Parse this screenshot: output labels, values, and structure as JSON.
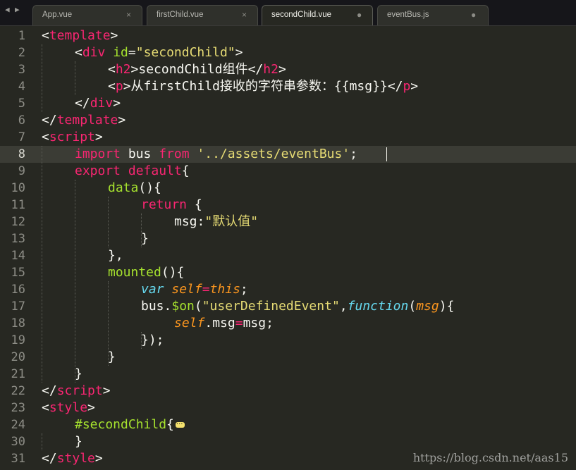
{
  "tabs": [
    {
      "label": "App.vue",
      "control": "×"
    },
    {
      "label": "firstChild.vue",
      "control": "×"
    },
    {
      "label": "secondChild.vue",
      "control": "●"
    },
    {
      "label": "eventBus.js",
      "control": "●"
    }
  ],
  "nav": {
    "back": "◀",
    "forward": "▶"
  },
  "line_numbers": [
    "1",
    "2",
    "3",
    "4",
    "5",
    "6",
    "7",
    "8",
    "9",
    "10",
    "11",
    "12",
    "13",
    "14",
    "15",
    "16",
    "17",
    "18",
    "19",
    "20",
    "21",
    "22",
    "23",
    "24",
    "30",
    "31"
  ],
  "code": {
    "l1": {
      "open": "<",
      "tag": "template",
      "close": ">"
    },
    "l2": {
      "open": "<",
      "tag": "div",
      "attr": "id",
      "eq": "=",
      "val": "\"secondChild\"",
      "close": ">"
    },
    "l3": {
      "open": "<",
      "tag": "h2",
      "close": ">",
      "text": "secondChild组件",
      "endopen": "</",
      "endtag": "h2",
      "endclose": ">"
    },
    "l4": {
      "open": "<",
      "tag": "p",
      "close": ">",
      "text": "从firstChild接收的字符串参数：{{msg}}",
      "endopen": "</",
      "endtag": "p",
      "endclose": ">"
    },
    "l5": {
      "open": "</",
      "tag": "div",
      "close": ">"
    },
    "l6": {
      "open": "</",
      "tag": "template",
      "close": ">"
    },
    "l7": {
      "open": "<",
      "tag": "script",
      "close": ">"
    },
    "l8": {
      "kw1": "import",
      "name": " bus ",
      "kw2": "from",
      "sp": " ",
      "str": "'../assets/eventBus'",
      "semi": ";"
    },
    "l9": {
      "kw1": "export",
      "sp": " ",
      "kw2": "default",
      "brace": "{"
    },
    "l10": {
      "fn": "data",
      "rest": "(){"
    },
    "l11": {
      "kw": "return",
      "rest": " {"
    },
    "l12": {
      "key": "msg:",
      "str": "\"默认值\""
    },
    "l13": {
      "text": "}"
    },
    "l14": {
      "text": "},"
    },
    "l15": {
      "fn": "mounted",
      "rest": "(){"
    },
    "l16": {
      "var": "var",
      "sp": " ",
      "self": "self",
      "eq": "=",
      "this": "this",
      "semi": ";"
    },
    "l17": {
      "obj": "bus.",
      "fn": "$on",
      "p1": "(",
      "str": "\"userDefinedEvent\"",
      "comma": ",",
      "func": "function",
      "p2": "(",
      "param": "msg",
      "p3": "){"
    },
    "l18": {
      "self": "self",
      "mid": ".msg",
      "eq": "=",
      "rest": "msg;"
    },
    "l19": {
      "text": "});"
    },
    "l20": {
      "text": "}"
    },
    "l21": {
      "text": "}"
    },
    "l22": {
      "open": "</",
      "tag": "script",
      "close": ">"
    },
    "l23": {
      "open": "<",
      "tag": "style",
      "close": ">"
    },
    "l24": {
      "sel": "#secondChild",
      "brace": "{"
    },
    "l30": {
      "text": "}"
    },
    "l31": {
      "open": "</",
      "tag": "style",
      "close": ">"
    }
  },
  "watermark": "https://blog.csdn.net/aas15",
  "colors": {
    "background": "#272822",
    "tag": "#f92672",
    "attribute": "#a6e22e",
    "string": "#e6db74",
    "storage": "#66d9ef",
    "parameter": "#fd971f"
  }
}
